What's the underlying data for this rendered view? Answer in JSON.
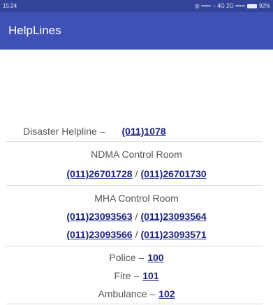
{
  "status_bar": {
    "time": "15:24",
    "indicators": "◎ ••••• ◌ 4G 2G •••••",
    "battery": "92%"
  },
  "app_bar": {
    "title": "HelpLines"
  },
  "disaster": {
    "label": "Disaster Helpline –",
    "number": "(011)1078"
  },
  "ndma": {
    "title": "NDMA Control Room",
    "numbers": [
      "(011)26701728",
      "(011)26701730"
    ]
  },
  "mha": {
    "title": "MHA Control Room",
    "numbers": [
      "(011)23093563",
      "(011)23093564",
      "(011)23093566",
      "(011)23093571"
    ]
  },
  "emergency": {
    "police_label": "Police –",
    "police_number": "100",
    "fire_label": "Fire –",
    "fire_number": "101",
    "ambulance_label": "Ambulance –",
    "ambulance_number": "102"
  },
  "separator": "/",
  "colors": {
    "status_bar": "#33449a",
    "app_bar": "#3f51b5",
    "link": "#1a237e",
    "text": "#555555"
  }
}
